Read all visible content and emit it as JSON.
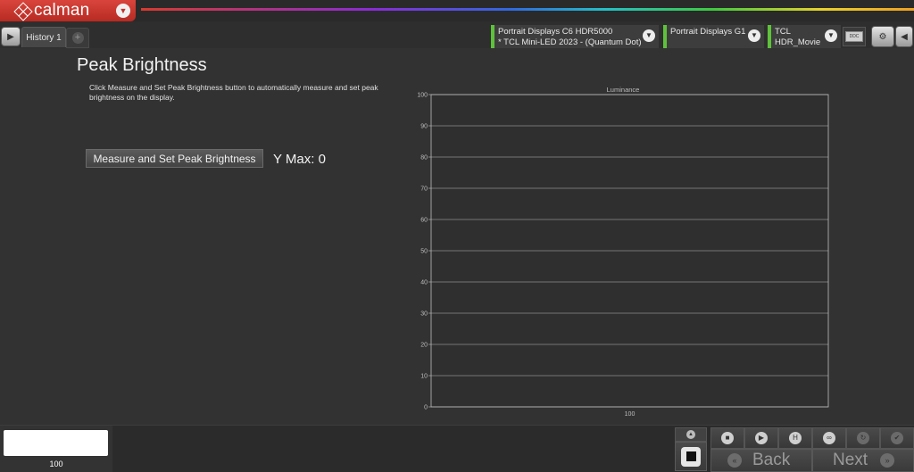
{
  "app": {
    "name": "calman"
  },
  "tabs": [
    {
      "label": "History 1"
    }
  ],
  "devices": [
    {
      "line1": "Portrait Displays C6 HDR5000",
      "line2": "* TCL Mini-LED 2023 - (Quantum Dot)"
    },
    {
      "line1": "Portrait Displays G1",
      "line2": ""
    },
    {
      "line1": "TCL",
      "line2": "HDR_Movie"
    }
  ],
  "page": {
    "title": "Peak Brightness",
    "instructions": "Click Measure and Set Peak Brightness button to automatically measure and set peak brightness on the display.",
    "measure_button": "Measure and Set Peak Brightness",
    "ymax_label": "Y Max:",
    "ymax_value": "0"
  },
  "chart_data": {
    "type": "bar",
    "title": "Luminance",
    "categories": [
      "100"
    ],
    "values": [
      0
    ],
    "ylim": [
      0,
      100
    ],
    "yticks": [
      0,
      10,
      20,
      30,
      40,
      50,
      60,
      70,
      80,
      90,
      100
    ],
    "grid": true,
    "xlabel": "",
    "ylabel": ""
  },
  "bottom": {
    "swatch_label": "100",
    "swatch_color": "#ffffff",
    "back_label": "Back",
    "next_label": "Next"
  },
  "colors": {
    "brand": "#c8342b",
    "device_connected": "#5ec23a",
    "background": "#323232"
  }
}
